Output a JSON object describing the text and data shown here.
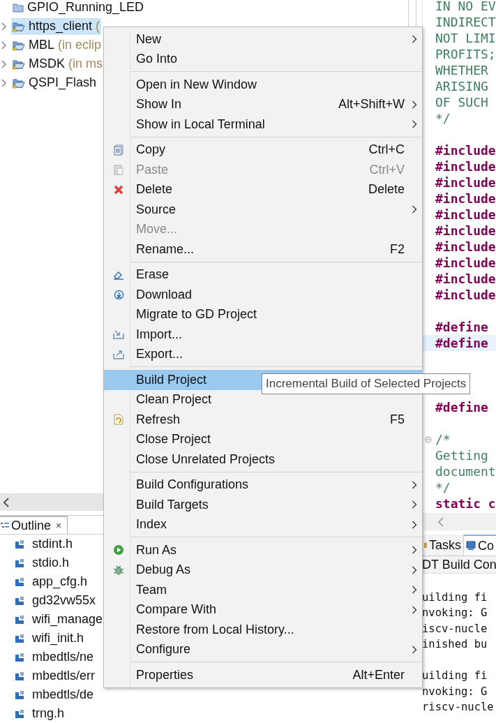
{
  "project_explorer": {
    "items": [
      {
        "kind": "folder",
        "name": "GPIO_Running_LED",
        "expandable": false,
        "selected": false
      },
      {
        "kind": "project",
        "name": "https_client",
        "note": "(",
        "expandable": true,
        "selected": true
      },
      {
        "kind": "project",
        "name": "MBL",
        "note": "(in eclip",
        "expandable": true,
        "selected": false
      },
      {
        "kind": "project",
        "name": "MSDK",
        "note": "(in ms",
        "expandable": true,
        "selected": false
      },
      {
        "kind": "project",
        "name": "QSPI_Flash",
        "expandable": true,
        "selected": false
      }
    ]
  },
  "outline": {
    "title": "Outline",
    "close": "×",
    "items": [
      "stdint.h",
      "stdio.h",
      "app_cfg.h",
      "gd32vw55x",
      "wifi_manage",
      "wifi_init.h",
      "mbedtls/ne",
      "mbedtls/err",
      "mbedtls/de",
      "trng.h"
    ]
  },
  "editor": {
    "lines": [
      {
        "kind": "comment",
        "text": "IN NO EV"
      },
      {
        "kind": "comment",
        "text": "INDIRECT"
      },
      {
        "kind": "comment",
        "text": "NOT LIMI"
      },
      {
        "kind": "comment",
        "text": "PROFITS;"
      },
      {
        "kind": "comment",
        "text": "WHETHER"
      },
      {
        "kind": "comment",
        "text": "ARISING"
      },
      {
        "kind": "comment",
        "text": "OF SUCH"
      },
      {
        "kind": "comment",
        "text": "*/"
      },
      {
        "kind": "blank"
      },
      {
        "kind": "directive",
        "text": "#include"
      },
      {
        "kind": "directive",
        "text": "#include"
      },
      {
        "kind": "directive",
        "text": "#include"
      },
      {
        "kind": "directive",
        "text": "#include"
      },
      {
        "kind": "directive",
        "text": "#include"
      },
      {
        "kind": "directive",
        "text": "#include"
      },
      {
        "kind": "directive",
        "text": "#include"
      },
      {
        "kind": "directive",
        "text": "#include"
      },
      {
        "kind": "directive",
        "text": "#include"
      },
      {
        "kind": "directive",
        "text": "#include"
      },
      {
        "kind": "blank"
      },
      {
        "kind": "directive",
        "text": "#define"
      },
      {
        "kind": "directive",
        "text": "#define",
        "highlighted": true
      },
      {
        "kind": "blank"
      },
      {
        "kind": "blank"
      },
      {
        "kind": "blank"
      },
      {
        "kind": "directive",
        "text": "#define"
      },
      {
        "kind": "blank"
      },
      {
        "kind": "comment",
        "text": "/*",
        "fold_marker": true
      },
      {
        "kind": "comment",
        "text": "Getting"
      },
      {
        "kind": "comment",
        "text": "document"
      },
      {
        "kind": "comment",
        "text": "*/"
      },
      {
        "kind": "directive",
        "text": "static c"
      }
    ]
  },
  "console": {
    "tabs": [
      {
        "label": "Tasks",
        "selected": false
      },
      {
        "label": "Co",
        "selected": true
      }
    ],
    "title": "DT Build Con",
    "lines": [
      {
        "kind": "blank"
      },
      {
        "kind": "text",
        "text": "uilding fi"
      },
      {
        "kind": "text",
        "text": "nvoking: G"
      },
      {
        "kind": "text",
        "text": "iscv-nucle"
      },
      {
        "kind": "text",
        "text": "inished bu"
      },
      {
        "kind": "blank"
      },
      {
        "kind": "text",
        "text": "uilding fi"
      },
      {
        "kind": "text",
        "text": "nvoking: G"
      },
      {
        "kind": "text",
        "text": "riscv-nucle"
      }
    ]
  },
  "context_menu": {
    "items": [
      {
        "kind": "item",
        "label": "New",
        "submenu": true,
        "disabled": false,
        "selected": false
      },
      {
        "kind": "item",
        "label": "Go Into",
        "submenu": false,
        "disabled": false,
        "selected": false
      },
      {
        "kind": "separator"
      },
      {
        "kind": "item",
        "label": "Open in New Window",
        "submenu": false,
        "disabled": false,
        "selected": false
      },
      {
        "kind": "item",
        "label": "Show In",
        "shortcut": "Alt+Shift+W",
        "submenu": true,
        "disabled": false,
        "selected": false
      },
      {
        "kind": "item",
        "label": "Show in Local Terminal",
        "submenu": true,
        "disabled": false,
        "selected": false
      },
      {
        "kind": "separator"
      },
      {
        "kind": "item",
        "label": "Copy",
        "shortcut": "Ctrl+C",
        "submenu": false,
        "disabled": false,
        "selected": false
      },
      {
        "kind": "item",
        "label": "Paste",
        "shortcut": "Ctrl+V",
        "submenu": false,
        "disabled": true,
        "selected": false
      },
      {
        "kind": "item",
        "label": "Delete",
        "shortcut": "Delete",
        "submenu": false,
        "disabled": false,
        "selected": false
      },
      {
        "kind": "item",
        "label": "Source",
        "submenu": true,
        "disabled": false,
        "selected": false
      },
      {
        "kind": "item",
        "label": "Move...",
        "submenu": false,
        "disabled": true,
        "selected": false
      },
      {
        "kind": "item",
        "label": "Rename...",
        "shortcut": "F2",
        "submenu": false,
        "disabled": false,
        "selected": false
      },
      {
        "kind": "separator"
      },
      {
        "kind": "item",
        "label": "Erase",
        "submenu": false,
        "disabled": false,
        "selected": false
      },
      {
        "kind": "item",
        "label": "Download",
        "submenu": false,
        "disabled": false,
        "selected": false
      },
      {
        "kind": "item",
        "label": "Migrate to GD Project",
        "submenu": false,
        "disabled": false,
        "selected": false
      },
      {
        "kind": "item",
        "label": "Import...",
        "submenu": false,
        "disabled": false,
        "selected": false
      },
      {
        "kind": "item",
        "label": "Export...",
        "submenu": false,
        "disabled": false,
        "selected": false
      },
      {
        "kind": "separator"
      },
      {
        "kind": "item",
        "label": "Build Project",
        "submenu": false,
        "disabled": false,
        "selected": true
      },
      {
        "kind": "item",
        "label": "Clean Project",
        "submenu": false,
        "disabled": false,
        "selected": false
      },
      {
        "kind": "item",
        "label": "Refresh",
        "shortcut": "F5",
        "submenu": false,
        "disabled": false,
        "selected": false
      },
      {
        "kind": "item",
        "label": "Close Project",
        "submenu": false,
        "disabled": false,
        "selected": false
      },
      {
        "kind": "item",
        "label": "Close Unrelated Projects",
        "submenu": false,
        "disabled": false,
        "selected": false
      },
      {
        "kind": "separator"
      },
      {
        "kind": "item",
        "label": "Build Configurations",
        "submenu": true,
        "disabled": false,
        "selected": false
      },
      {
        "kind": "item",
        "label": "Build Targets",
        "submenu": true,
        "disabled": false,
        "selected": false
      },
      {
        "kind": "item",
        "label": "Index",
        "submenu": true,
        "disabled": false,
        "selected": false
      },
      {
        "kind": "separator"
      },
      {
        "kind": "item",
        "label": "Run As",
        "submenu": true,
        "disabled": false,
        "selected": false
      },
      {
        "kind": "item",
        "label": "Debug As",
        "submenu": true,
        "disabled": false,
        "selected": false
      },
      {
        "kind": "item",
        "label": "Team",
        "submenu": true,
        "disabled": false,
        "selected": false
      },
      {
        "kind": "item",
        "label": "Compare With",
        "submenu": true,
        "disabled": false,
        "selected": false
      },
      {
        "kind": "item",
        "label": "Restore from Local History...",
        "submenu": false,
        "disabled": false,
        "selected": false
      },
      {
        "kind": "item",
        "label": "Configure",
        "submenu": true,
        "disabled": false,
        "selected": false
      },
      {
        "kind": "separator"
      },
      {
        "kind": "item",
        "label": "Properties",
        "shortcut": "Alt+Enter",
        "submenu": false,
        "disabled": false,
        "selected": false
      }
    ]
  },
  "tooltip": {
    "text": "Incremental Build of Selected Projects"
  }
}
